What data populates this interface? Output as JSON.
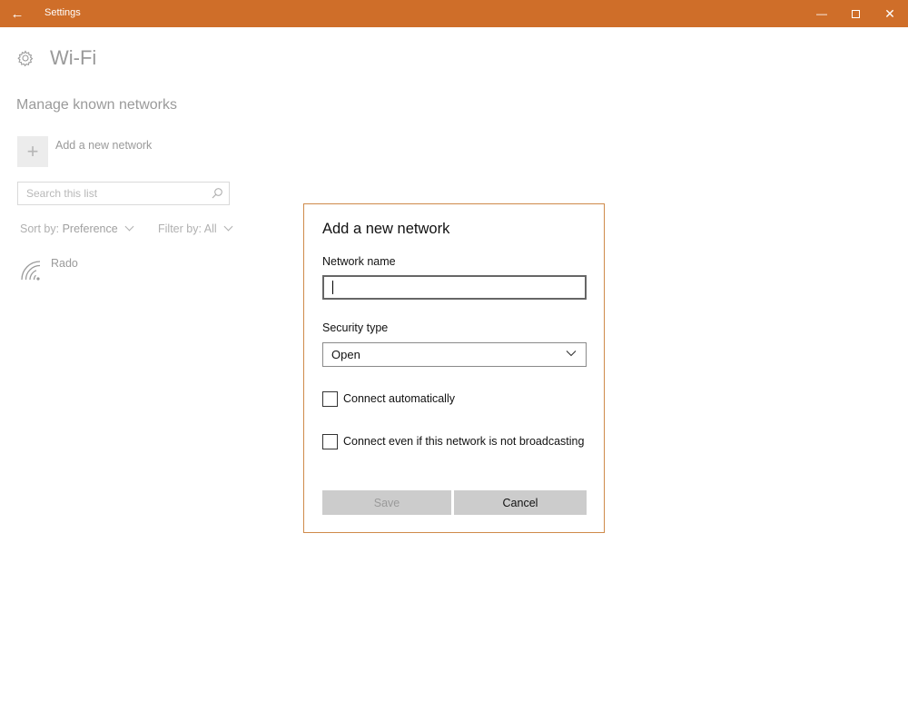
{
  "window": {
    "title": "Settings",
    "back_glyph": "←",
    "minimize_glyph": "—",
    "close_glyph": "✕",
    "accent": "#cf6e29"
  },
  "page": {
    "title": "Wi-Fi",
    "section_title": "Manage known networks",
    "add_network_label": "Add a new network",
    "search_placeholder": "Search this list",
    "sort_prefix": "Sort by:",
    "sort_value": "Preference",
    "filter_prefix": "Filter by:",
    "filter_value": "All",
    "networks": [
      {
        "name": "Rado",
        "icon": "wifi-signal-icon"
      }
    ]
  },
  "dialog": {
    "title": "Add a new network",
    "network_name_label": "Network name",
    "network_name_value": "",
    "security_type_label": "Security type",
    "security_type_value": "Open",
    "connect_automatically_label": "Connect automatically",
    "connect_automatically_checked": false,
    "connect_hidden_label": "Connect even if this network is not broadcasting",
    "connect_hidden_checked": false,
    "save_label": "Save",
    "cancel_label": "Cancel",
    "border_color": "#cf8a4a"
  }
}
